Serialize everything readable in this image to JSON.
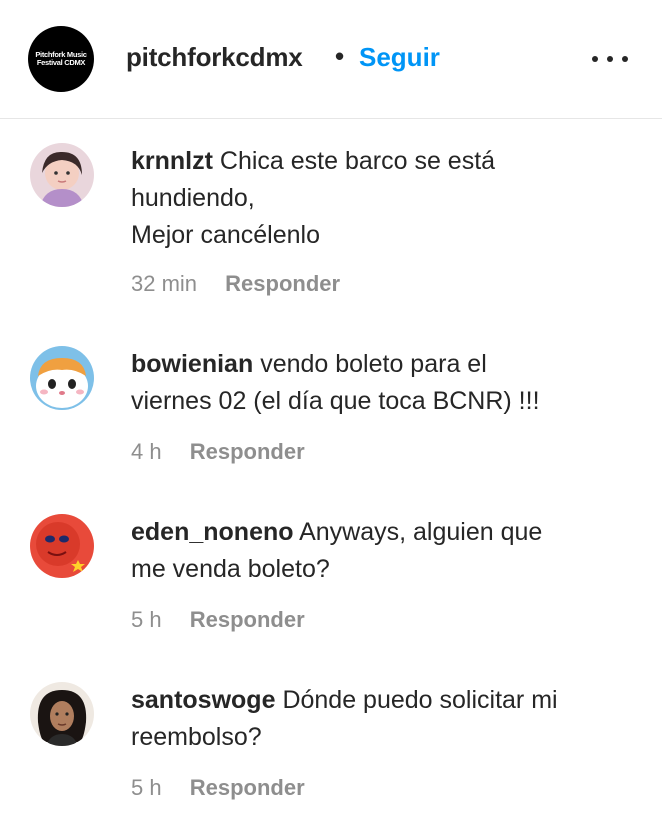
{
  "header": {
    "logo_text": "Pitchfork Music Festival CDMX",
    "account": "pitchforkcdmx",
    "separator": "•",
    "follow_label": "Seguir"
  },
  "comments": [
    {
      "username": "krnnlzt",
      "text": "Chica este barco se está hundiendo,\nMejor cancélenlo",
      "time": "32 min",
      "reply_label": "Responder"
    },
    {
      "username": "bowienian",
      "text": "vendo boleto para el viernes 02 (el día que toca BCNR) !!!",
      "time": "4 h",
      "reply_label": "Responder"
    },
    {
      "username": "eden_noneno",
      "text": "Anyways, alguien que me venda boleto?",
      "time": "5 h",
      "reply_label": "Responder"
    },
    {
      "username": "santoswoge",
      "text": "Dónde puedo solicitar mi reembolso?",
      "time": "5 h",
      "reply_label": "Responder"
    }
  ],
  "colors": {
    "follow": "#0095f6",
    "muted": "#8e8e8e",
    "text": "#262626"
  }
}
